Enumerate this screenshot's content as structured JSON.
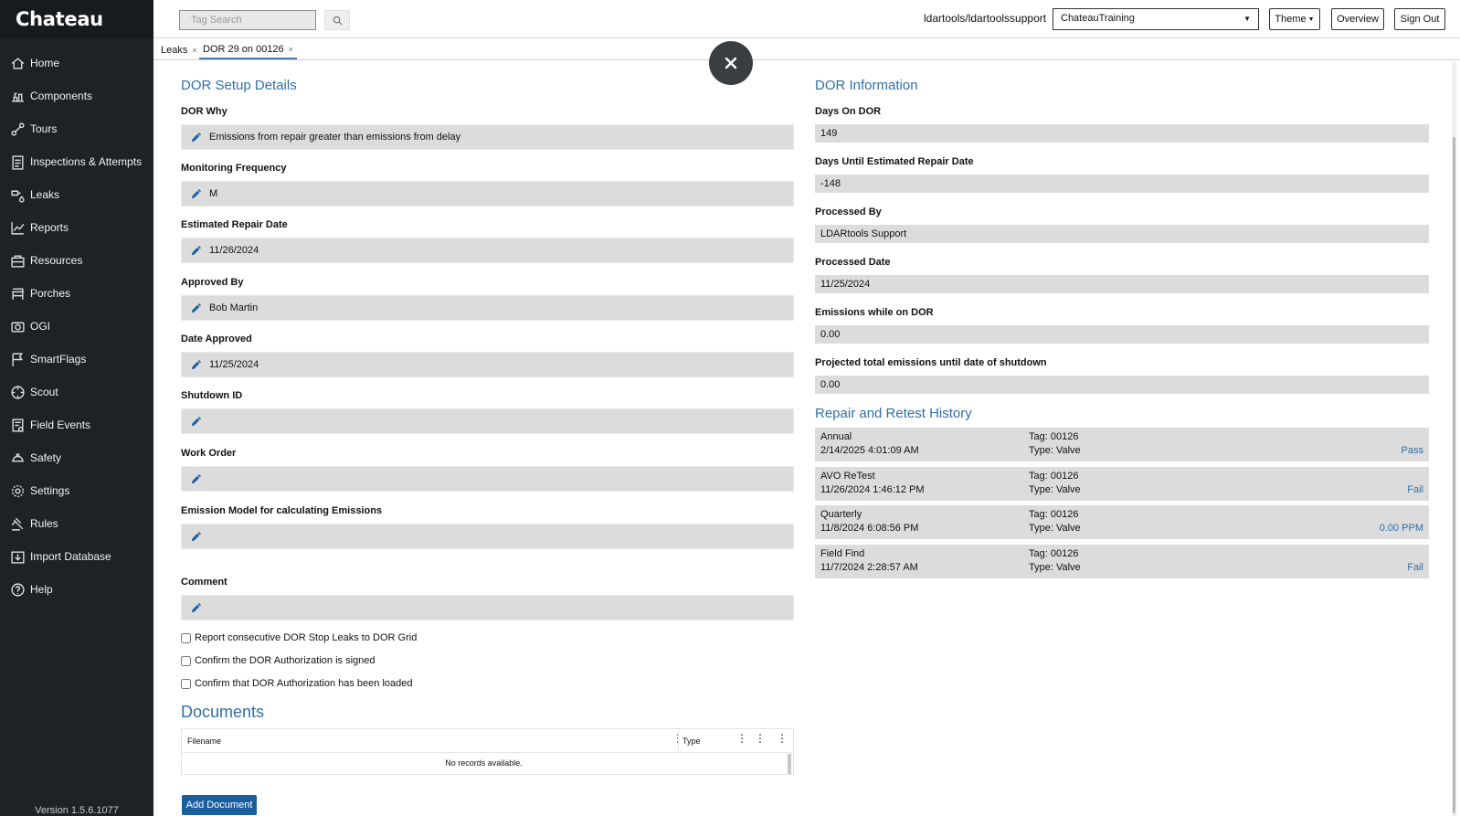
{
  "app": {
    "logo": "Chateau",
    "version": "Version 1.5.6.1077"
  },
  "sidebar": {
    "items": [
      {
        "label": "Home",
        "icon": "home-icon"
      },
      {
        "label": "Components",
        "icon": "components-icon"
      },
      {
        "label": "Tours",
        "icon": "tours-icon"
      },
      {
        "label": "Inspections & Attempts",
        "icon": "clipboard-icon"
      },
      {
        "label": "Leaks",
        "icon": "leak-icon"
      },
      {
        "label": "Reports",
        "icon": "chart-icon"
      },
      {
        "label": "Resources",
        "icon": "resources-icon"
      },
      {
        "label": "Porches",
        "icon": "porch-icon"
      },
      {
        "label": "OGI",
        "icon": "camera-icon"
      },
      {
        "label": "SmartFlags",
        "icon": "flag-icon"
      },
      {
        "label": "Scout",
        "icon": "scout-icon"
      },
      {
        "label": "Field Events",
        "icon": "field-events-icon"
      },
      {
        "label": "Safety",
        "icon": "hardhat-icon"
      },
      {
        "label": "Settings",
        "icon": "gear-icon"
      },
      {
        "label": "Rules",
        "icon": "gavel-icon"
      },
      {
        "label": "Import Database",
        "icon": "import-icon"
      },
      {
        "label": "Help",
        "icon": "help-icon"
      }
    ]
  },
  "header": {
    "tag_search_placeholder": "Tag Search",
    "user": "ldartools/ldartoolssupport",
    "database": "ChateauTraining",
    "theme_label": "Theme",
    "overview_label": "Overview",
    "signout_label": "Sign Out"
  },
  "tabs": [
    {
      "label": "Leaks"
    },
    {
      "label": "DOR 29 on 00126"
    }
  ],
  "setup": {
    "title": "DOR Setup Details",
    "fields": [
      {
        "label": "DOR Why",
        "value": "Emissions from repair greater than emissions from delay"
      },
      {
        "label": "Monitoring Frequency",
        "value": "M"
      },
      {
        "label": "Estimated Repair Date",
        "value": "11/26/2024"
      },
      {
        "label": "Approved By",
        "value": "Bob Martin"
      },
      {
        "label": "Date Approved",
        "value": "11/25/2024"
      },
      {
        "label": "Shutdown ID",
        "value": ""
      },
      {
        "label": "Work Order",
        "value": ""
      },
      {
        "label": "Emission Model for calculating Emissions",
        "value": ""
      },
      {
        "label": "Comment",
        "value": ""
      }
    ],
    "checkboxes": [
      {
        "label": "Report consecutive DOR Stop Leaks to DOR Grid",
        "checked": false
      },
      {
        "label": "Confirm the DOR Authorization is signed",
        "checked": false
      },
      {
        "label": "Confirm that DOR Authorization has been loaded",
        "checked": false
      }
    ]
  },
  "documents": {
    "title": "Documents",
    "columns": [
      "Filename",
      "Type"
    ],
    "empty_text": "No records available.",
    "add_label": "Add Document"
  },
  "info": {
    "title": "DOR Information",
    "fields": [
      {
        "label": "Days On DOR",
        "value": "149"
      },
      {
        "label": "Days Until Estimated Repair Date",
        "value": "-148"
      },
      {
        "label": "Processed By",
        "value": "LDARtools Support"
      },
      {
        "label": "Processed Date",
        "value": "11/25/2024"
      },
      {
        "label": "Emissions while on DOR",
        "value": "0.00"
      },
      {
        "label": "Projected total emissions until date of shutdown",
        "value": "0.00"
      }
    ]
  },
  "history": {
    "title": "Repair and Retest History",
    "items": [
      {
        "type": "Annual",
        "datetime": "2/14/2025 4:01:09 AM",
        "tag": "Tag: 00126",
        "component": "Type: Valve",
        "result": "Pass"
      },
      {
        "type": "AVO ReTest",
        "datetime": "11/26/2024 1:46:12 PM",
        "tag": "Tag: 00126",
        "component": "Type: Valve",
        "result": "Fail"
      },
      {
        "type": "Quarterly",
        "datetime": "11/8/2024 6:08:56 PM",
        "tag": "Tag: 00126",
        "component": "Type: Valve",
        "result": "0.00 PPM"
      },
      {
        "type": "Field Find",
        "datetime": "11/7/2024 2:28:57 AM",
        "tag": "Tag: 00126",
        "component": "Type: Valve",
        "result": "Fail"
      }
    ]
  }
}
